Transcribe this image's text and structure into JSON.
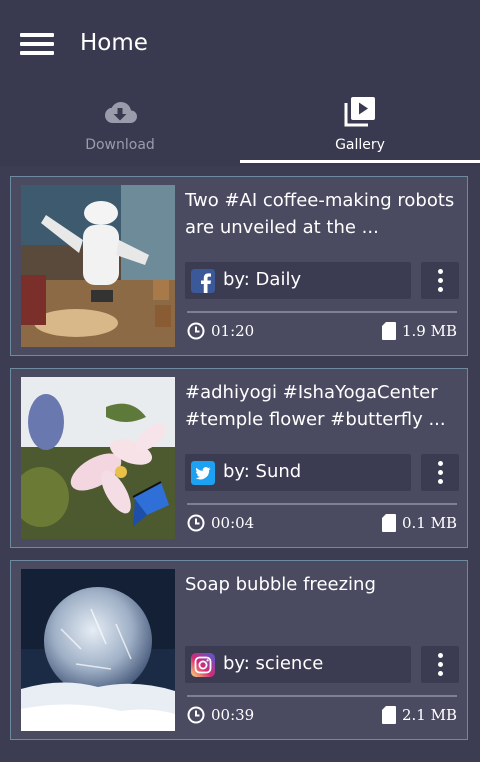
{
  "appbar": {
    "title": "Home"
  },
  "tabs": [
    {
      "label": "Download",
      "icon": "cloud-download-icon",
      "active": false
    },
    {
      "label": "Gallery",
      "icon": "play-library-icon",
      "active": true
    }
  ],
  "colors": {
    "background": "#3c3d52",
    "card": "#4a4b61",
    "card_border": "#6f8aa0",
    "facebook": "#3b5998",
    "twitter": "#1da1f2",
    "instagram_gradient": [
      "#feda75",
      "#d62976",
      "#4f5bd5"
    ]
  },
  "items": [
    {
      "title": "Two #AI coffee-making robots are unveiled at the ...",
      "author": "by: Daily",
      "source": "facebook",
      "source_icon": "facebook-icon",
      "duration": "01:20",
      "size": "1.9 MB",
      "thumbnail": "robot-coffee-thumbnail"
    },
    {
      "title": "#adhiyogi #IshaYogaCenter #temple flower #butterfly ...",
      "author": "by: Sund",
      "source": "twitter",
      "source_icon": "twitter-icon",
      "duration": "00:04",
      "size": "0.1 MB",
      "thumbnail": "flower-butterfly-thumbnail"
    },
    {
      "title": "Soap bubble freezing",
      "author": "by: science",
      "source": "instagram",
      "source_icon": "instagram-icon",
      "duration": "00:39",
      "size": "2.1 MB",
      "thumbnail": "frozen-bubble-thumbnail"
    }
  ]
}
